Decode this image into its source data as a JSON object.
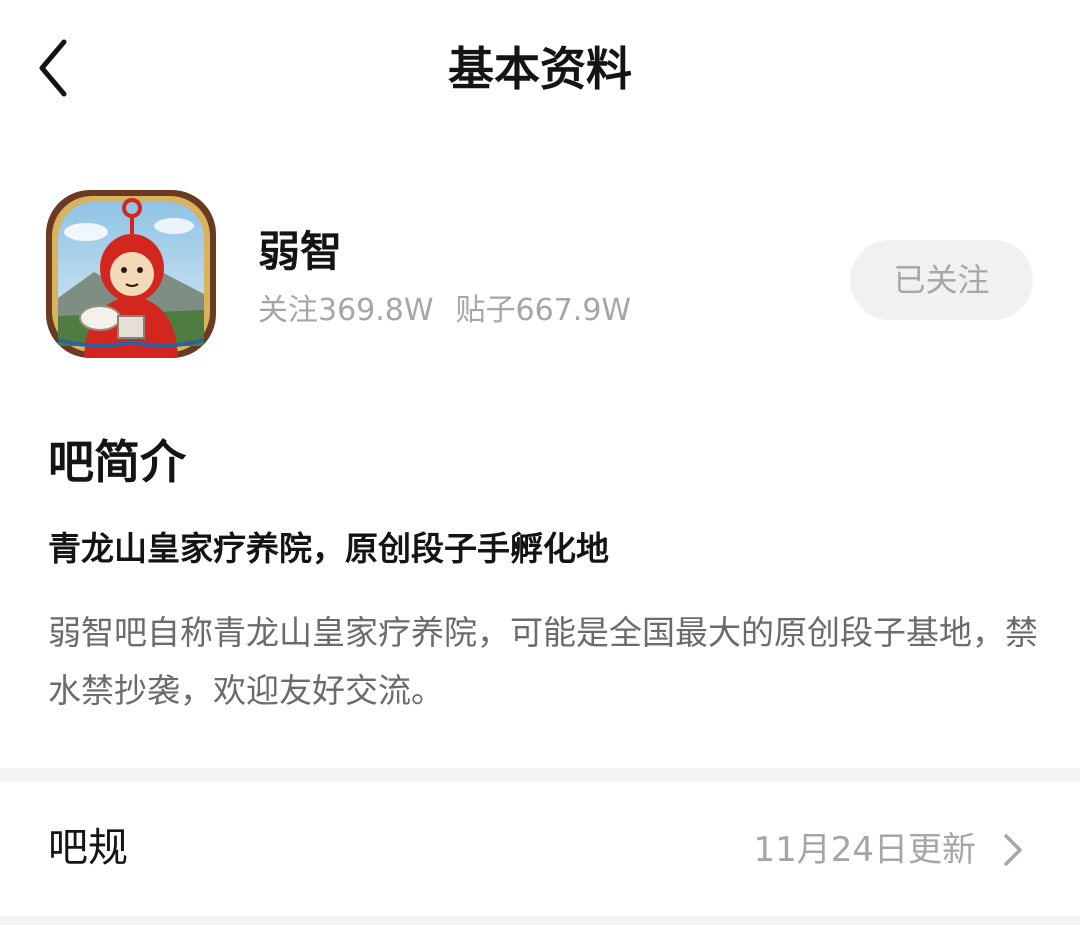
{
  "nav": {
    "title": "基本资料",
    "back_icon": "chevron-left-icon"
  },
  "forum": {
    "name": "弱智",
    "followers": "关注369.8W",
    "posts": "贴子667.9W",
    "follow_button": "已关注",
    "avatar_icon": "forum-avatar-image"
  },
  "intro": {
    "title": "吧简介",
    "headline": "青龙山皇家疗养院，原创段子手孵化地",
    "body": "弱智吧自称青龙山皇家疗养院，可能是全国最大的原创段子基地，禁水禁抄袭，欢迎友好交流。"
  },
  "rules": {
    "label": "吧规",
    "updated": "11月24日更新",
    "chevron_icon": "chevron-right-icon"
  },
  "colors": {
    "primary_text": "#141414",
    "secondary_text": "#a6a6a6",
    "body_text": "#6b6b6b",
    "button_bg": "#f1f1f3",
    "divider": "#f4f4f6"
  }
}
